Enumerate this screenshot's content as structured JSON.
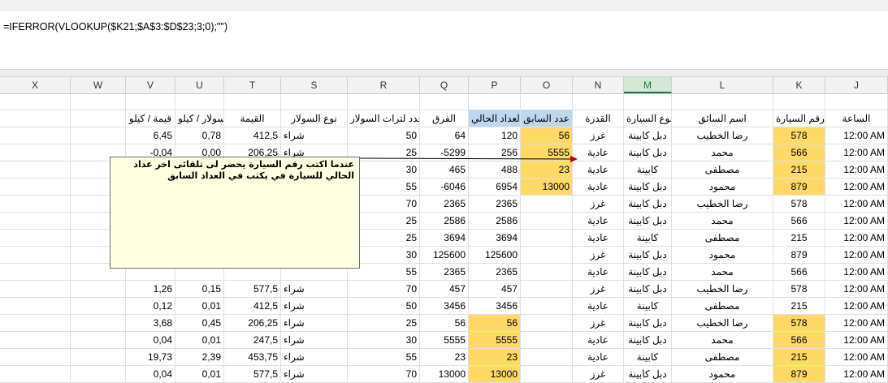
{
  "formula": "=IFERROR(VLOOKUP($K21;$A$3:$D$23;3;0);\"\")",
  "columns": [
    "X",
    "W",
    "V",
    "U",
    "T",
    "S",
    "R",
    "Q",
    "P",
    "O",
    "N",
    "M",
    "L",
    "K",
    "J"
  ],
  "headers": {
    "V": "قيمة / كيلو",
    "U": "سولار / كيلو",
    "T": "القيمة",
    "S": "نوع السولار",
    "R": "عدد لترات السولار",
    "Q": "الفرق",
    "P": "العداد الحالي",
    "O": "عدد السابق",
    "N": "القدرة",
    "M": "نوع السيارة",
    "L": "اسم السائق",
    "K": "رقم السيارة",
    "J": "الساعة"
  },
  "rows": [
    {
      "V": "6,45",
      "U": "0,78",
      "T": "412,5",
      "S": "شراء",
      "R": "50",
      "Q": "64",
      "P": "120",
      "O": "56",
      "N": "غرز",
      "M": "دبل كابينة",
      "L": "رضا الخطيب",
      "K": "578",
      "J": "12:00 AM"
    },
    {
      "V": "-0,04",
      "U": "0,00",
      "T": "206,25",
      "S": "شراء",
      "R": "25",
      "Q": "-5299",
      "P": "256",
      "O": "5555",
      "N": "عادية",
      "M": "دبل كابينة",
      "L": "محمد",
      "K": "566",
      "J": "12:00 AM"
    },
    {
      "V": "",
      "U": "",
      "T": "",
      "S": "",
      "R": "30",
      "Q": "465",
      "P": "488",
      "O": "23",
      "N": "عادية",
      "M": "كابينة",
      "L": "مصطفى",
      "K": "215",
      "J": "12:00 AM"
    },
    {
      "V": "",
      "U": "",
      "T": "",
      "S": "",
      "R": "55",
      "Q": "-6046",
      "P": "6954",
      "O": "13000",
      "N": "عادية",
      "M": "دبل كابينة",
      "L": "محمود",
      "K": "879",
      "J": "12:00 AM"
    },
    {
      "V": "",
      "U": "",
      "T": "",
      "S": "",
      "R": "70",
      "Q": "2365",
      "P": "2365",
      "O": "",
      "N": "غرز",
      "M": "دبل كابينة",
      "L": "رضا الخطيب",
      "K": "578",
      "J": "12:00 AM"
    },
    {
      "V": "",
      "U": "",
      "T": "",
      "S": "",
      "R": "25",
      "Q": "2586",
      "P": "2586",
      "O": "",
      "N": "عادية",
      "M": "دبل كابينة",
      "L": "محمد",
      "K": "566",
      "J": "12:00 AM"
    },
    {
      "V": "",
      "U": "",
      "T": "",
      "S": "",
      "R": "25",
      "Q": "3694",
      "P": "3694",
      "O": "",
      "N": "عادية",
      "M": "كابينة",
      "L": "مصطفى",
      "K": "215",
      "J": "12:00 AM"
    },
    {
      "V": "",
      "U": "",
      "T": "",
      "S": "",
      "R": "30",
      "Q": "125600",
      "P": "125600",
      "O": "",
      "N": "غرز",
      "M": "دبل كابينة",
      "L": "محمود",
      "K": "879",
      "J": "12:00 AM"
    },
    {
      "V": "",
      "U": "",
      "T": "",
      "S": "",
      "R": "55",
      "Q": "2365",
      "P": "2365",
      "O": "",
      "N": "عادية",
      "M": "دبل كابينة",
      "L": "محمد",
      "K": "566",
      "J": "12:00 AM"
    },
    {
      "V": "1,26",
      "U": "0,15",
      "T": "577,5",
      "S": "شراء",
      "R": "70",
      "Q": "457",
      "P": "457",
      "O": "",
      "N": "غرز",
      "M": "دبل كابينة",
      "L": "رضا الخطيب",
      "K": "578",
      "J": "12:00 AM"
    },
    {
      "V": "0,12",
      "U": "0,01",
      "T": "412,5",
      "S": "شراء",
      "R": "50",
      "Q": "3456",
      "P": "3456",
      "O": "",
      "N": "عادية",
      "M": "كابينة",
      "L": "مصطفى",
      "K": "215",
      "J": "12:00 AM"
    },
    {
      "V": "3,68",
      "U": "0,45",
      "T": "206,25",
      "S": "شراء",
      "R": "25",
      "Q": "56",
      "P": "56",
      "O": "",
      "N": "غرز",
      "M": "دبل كابينة",
      "L": "رضا الخطيب",
      "K": "578",
      "J": "12:00 AM"
    },
    {
      "V": "0,04",
      "U": "0,01",
      "T": "247,5",
      "S": "شراء",
      "R": "30",
      "Q": "5555",
      "P": "5555",
      "O": "",
      "N": "عادية",
      "M": "دبل كابينة",
      "L": "محمد",
      "K": "566",
      "J": "12:00 AM"
    },
    {
      "V": "19,73",
      "U": "2,39",
      "T": "453,75",
      "S": "شراء",
      "R": "55",
      "Q": "23",
      "P": "23",
      "O": "",
      "N": "عادية",
      "M": "كابينة",
      "L": "مصطفى",
      "K": "215",
      "J": "12:00 AM"
    },
    {
      "V": "0,04",
      "U": "0,01",
      "T": "577,5",
      "S": "شراء",
      "R": "70",
      "Q": "13000",
      "P": "13000",
      "O": "",
      "N": "غرز",
      "M": "دبل كابينة",
      "L": "محمود",
      "K": "879",
      "J": "12:00 AM"
    }
  ],
  "comment_text": "عندما اكتب رقم السيارة يحضر لى تلقائى اخر عداد الحالي للسيارة في  يكتب في العداد السابق",
  "colors": {
    "highlight": "#ffd966",
    "header_blue": "#bdd7ee",
    "comment_bg": "#ffffe1",
    "selected_col": "#217346"
  }
}
